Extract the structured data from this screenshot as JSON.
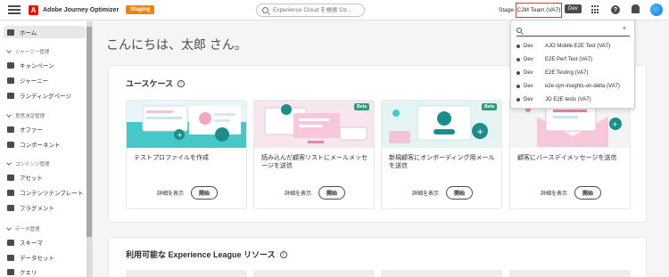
{
  "topbar": {
    "app_name": "Adobe Journey Optimizer",
    "logo_letter": "A",
    "staging_badge": "Staging",
    "search_placeholder": "Experience Cloud を検索 Ctr...",
    "stage_label": "Stage",
    "org_name": "CJM Team (VA7)",
    "dev_badge": "Dev",
    "help_glyph": "?",
    "icons": [
      "menu-icon",
      "adobe-logo-icon",
      "search-icon",
      "apps-grid-icon",
      "help-icon",
      "bell-icon",
      "avatar"
    ]
  },
  "sidebar": {
    "home": "ホーム",
    "sections": [
      {
        "head": "ジャーニー管理",
        "items": [
          "キャンペーン",
          "ジャーニー",
          "ランディングページ"
        ]
      },
      {
        "head": "意思決定管理",
        "items": [
          "オファー",
          "コンポーネント"
        ]
      },
      {
        "head": "コンテンツ管理",
        "items": [
          "アセット",
          "コンテンツテンプレート",
          "フラグメント"
        ]
      },
      {
        "head": "データ管理",
        "items": [
          "スキーマ",
          "データセット",
          "クエリ"
        ]
      }
    ]
  },
  "main": {
    "greeting": "こんにちは、太郎 さん。",
    "usecases": {
      "title": "ユースケース",
      "info": "i",
      "cards": [
        {
          "title": "テストプロファイルを作成",
          "beta": "",
          "details": "詳細を表示",
          "start": "開始"
        },
        {
          "title": "読み込んだ顧客リストにメールメッセージを送信",
          "beta": "Beta",
          "details": "詳細を表示",
          "start": "開始"
        },
        {
          "title": "新規顧客にオンボーディング用メールを送信",
          "beta": "Beta",
          "details": "詳細を表示",
          "start": "開始"
        },
        {
          "title": "顧客にバースデイメッセージを送信",
          "beta": "",
          "details": "詳細を表示",
          "start": "開始"
        }
      ]
    },
    "resources": {
      "title": "利用可能な Experience League リソース",
      "info": "i"
    }
  },
  "dropdown": {
    "search_value": "",
    "clear": "×",
    "rows": [
      {
        "env": "Dev",
        "name": "AJO Mobile E2E Test (VA7)"
      },
      {
        "env": "Dev",
        "name": "E2E Perf Test (VA7)"
      },
      {
        "env": "Dev",
        "name": "E2E Testing (VA7)"
      },
      {
        "env": "Dev",
        "name": "e2e-cjm-insights-on-delta (VA7)"
      },
      {
        "env": "Dev",
        "name": "JO E2E tests (VA7)"
      }
    ]
  },
  "colors": {
    "accent_red": "#eb1000",
    "staging_orange": "#e68619",
    "beta_green": "#2d9d78",
    "highlight_border": "#d7373f"
  }
}
